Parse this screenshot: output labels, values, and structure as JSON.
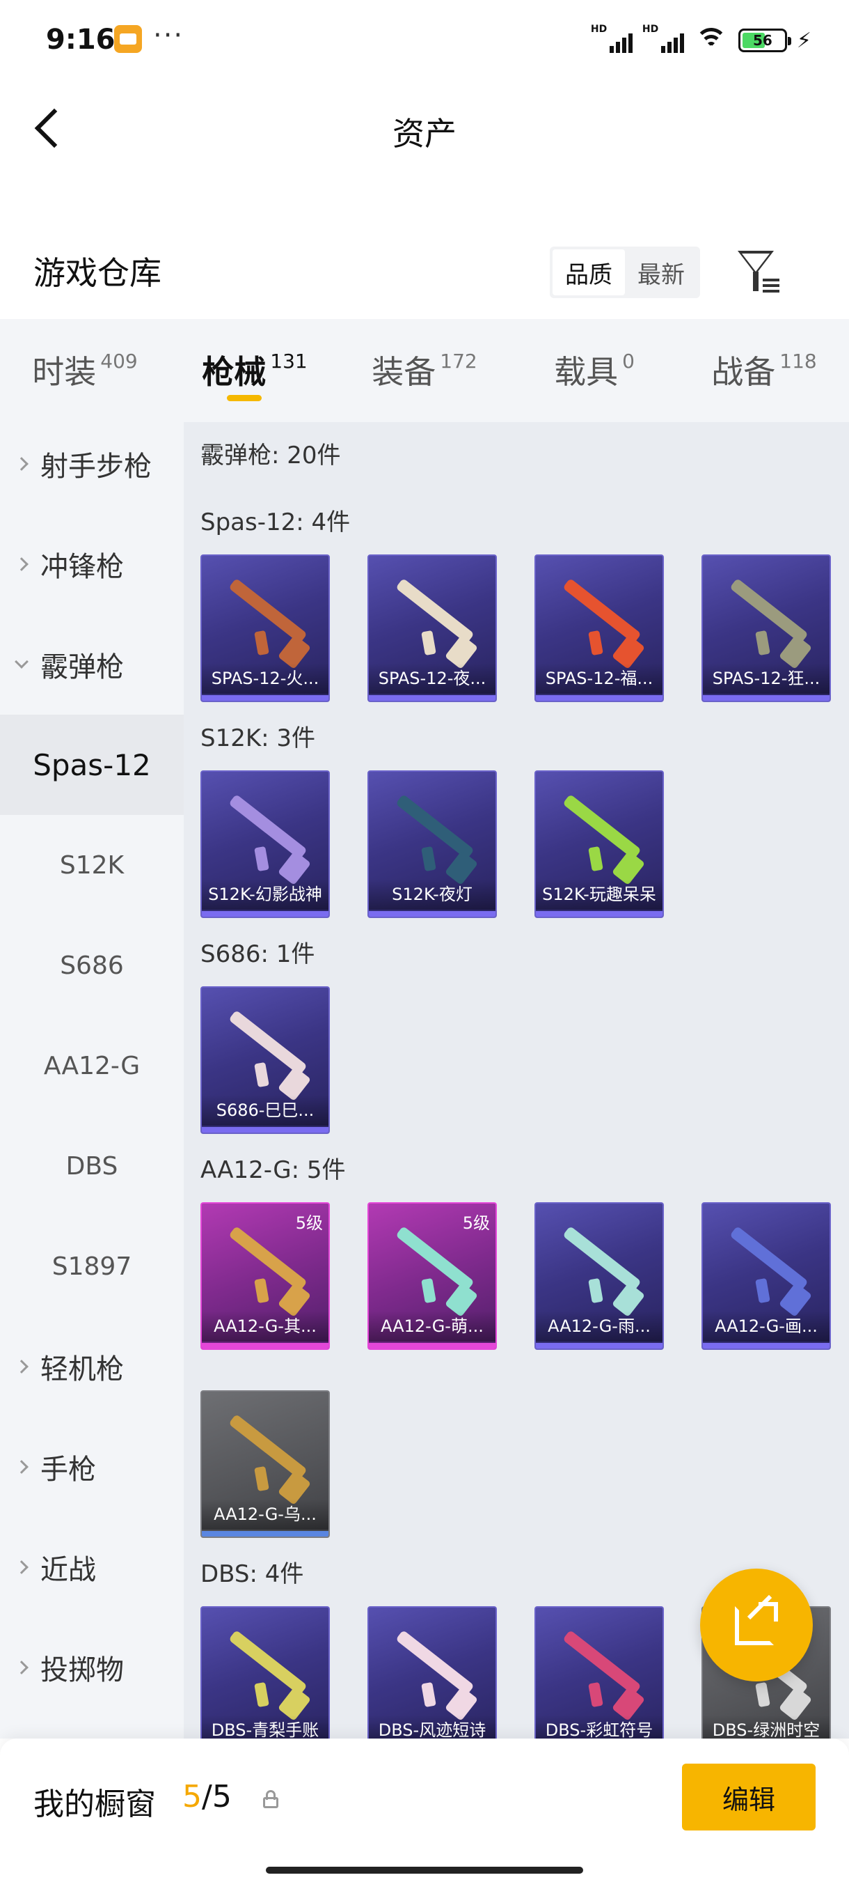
{
  "status_bar": {
    "time": "9:16",
    "more": "···",
    "battery_level": "56",
    "battery_percent": 56
  },
  "header": {
    "title": "资产"
  },
  "warehouse": {
    "title": "游戏仓库",
    "sort_options": [
      "品质",
      "最新"
    ],
    "sort_selected": "品质"
  },
  "tabs": [
    {
      "label": "时装",
      "count": "409"
    },
    {
      "label": "枪械",
      "count": "131",
      "active": true
    },
    {
      "label": "装备",
      "count": "172"
    },
    {
      "label": "载具",
      "count": "0"
    },
    {
      "label": "战备",
      "count": "118"
    }
  ],
  "sidebar": {
    "items": [
      {
        "label": "射手步枪",
        "type": "category"
      },
      {
        "label": "冲锋枪",
        "type": "category"
      },
      {
        "label": "霰弹枪",
        "type": "category",
        "expanded": true
      },
      {
        "label": "Spas-12",
        "type": "sub",
        "selected": true
      },
      {
        "label": "S12K",
        "type": "sub"
      },
      {
        "label": "S686",
        "type": "sub"
      },
      {
        "label": "AA12-G",
        "type": "sub"
      },
      {
        "label": "DBS",
        "type": "sub"
      },
      {
        "label": "S1897",
        "type": "sub"
      },
      {
        "label": "轻机枪",
        "type": "category"
      },
      {
        "label": "手枪",
        "type": "category"
      },
      {
        "label": "近战",
        "type": "category"
      },
      {
        "label": "投掷物",
        "type": "category"
      }
    ]
  },
  "content": {
    "category_header": "霰弹枪: 20件",
    "groups": [
      {
        "title": "Spas-12: 4件",
        "items": [
          {
            "name": "SPAS-12-火...",
            "rarity": "purple",
            "gun_color": "#c0653a"
          },
          {
            "name": "SPAS-12-夜...",
            "rarity": "purple",
            "gun_color": "#e8dcc8"
          },
          {
            "name": "SPAS-12-福...",
            "rarity": "purple",
            "gun_color": "#e6532f"
          },
          {
            "name": "SPAS-12-狂...",
            "rarity": "purple",
            "gun_color": "#9b9b7e"
          }
        ]
      },
      {
        "title": "S12K: 3件",
        "items": [
          {
            "name": "S12K-幻影战神",
            "rarity": "purple",
            "gun_color": "#a48ee0"
          },
          {
            "name": "S12K-夜灯",
            "rarity": "purple",
            "gun_color": "#2f5e78"
          },
          {
            "name": "S12K-玩趣呆呆",
            "rarity": "purple",
            "gun_color": "#9ad845"
          }
        ]
      },
      {
        "title": "S686: 1件",
        "items": [
          {
            "name": "S686-巳巳...",
            "rarity": "purple",
            "gun_color": "#e9d8dc"
          }
        ]
      },
      {
        "title": "AA12-G: 5件",
        "items": [
          {
            "name": "AA12-G-其...",
            "rarity": "pink",
            "level": "5级",
            "gun_color": "#d8a24a"
          },
          {
            "name": "AA12-G-萌...",
            "rarity": "pink",
            "level": "5级",
            "gun_color": "#8fe0cf"
          },
          {
            "name": "AA12-G-雨...",
            "rarity": "purple",
            "gun_color": "#a8e0d8"
          },
          {
            "name": "AA12-G-画...",
            "rarity": "purple",
            "gun_color": "#6070d8"
          },
          {
            "name": "AA12-G-乌...",
            "rarity": "grey",
            "gun_color": "#c89a40"
          }
        ]
      },
      {
        "title": "DBS: 4件",
        "items": [
          {
            "name": "DBS-青梨手账",
            "rarity": "purple",
            "gun_color": "#d8d060"
          },
          {
            "name": "DBS-风迹短诗",
            "rarity": "purple",
            "gun_color": "#f0d8e4"
          },
          {
            "name": "DBS-彩虹符号",
            "rarity": "purple",
            "gun_color": "#d84878"
          },
          {
            "name": "DBS-绿洲时空",
            "rarity": "grey",
            "gun_color": "#d8d8d8"
          }
        ]
      }
    ]
  },
  "bottom": {
    "window_label": "我的橱窗",
    "window_current": "5",
    "window_separator": "/",
    "window_total": "5",
    "edit_label": "编辑"
  },
  "colors": {
    "accent": "#f7b500",
    "purple_card": "#3b3585",
    "pink_card": "#7f2a8d",
    "grey_card": "#55565a"
  }
}
